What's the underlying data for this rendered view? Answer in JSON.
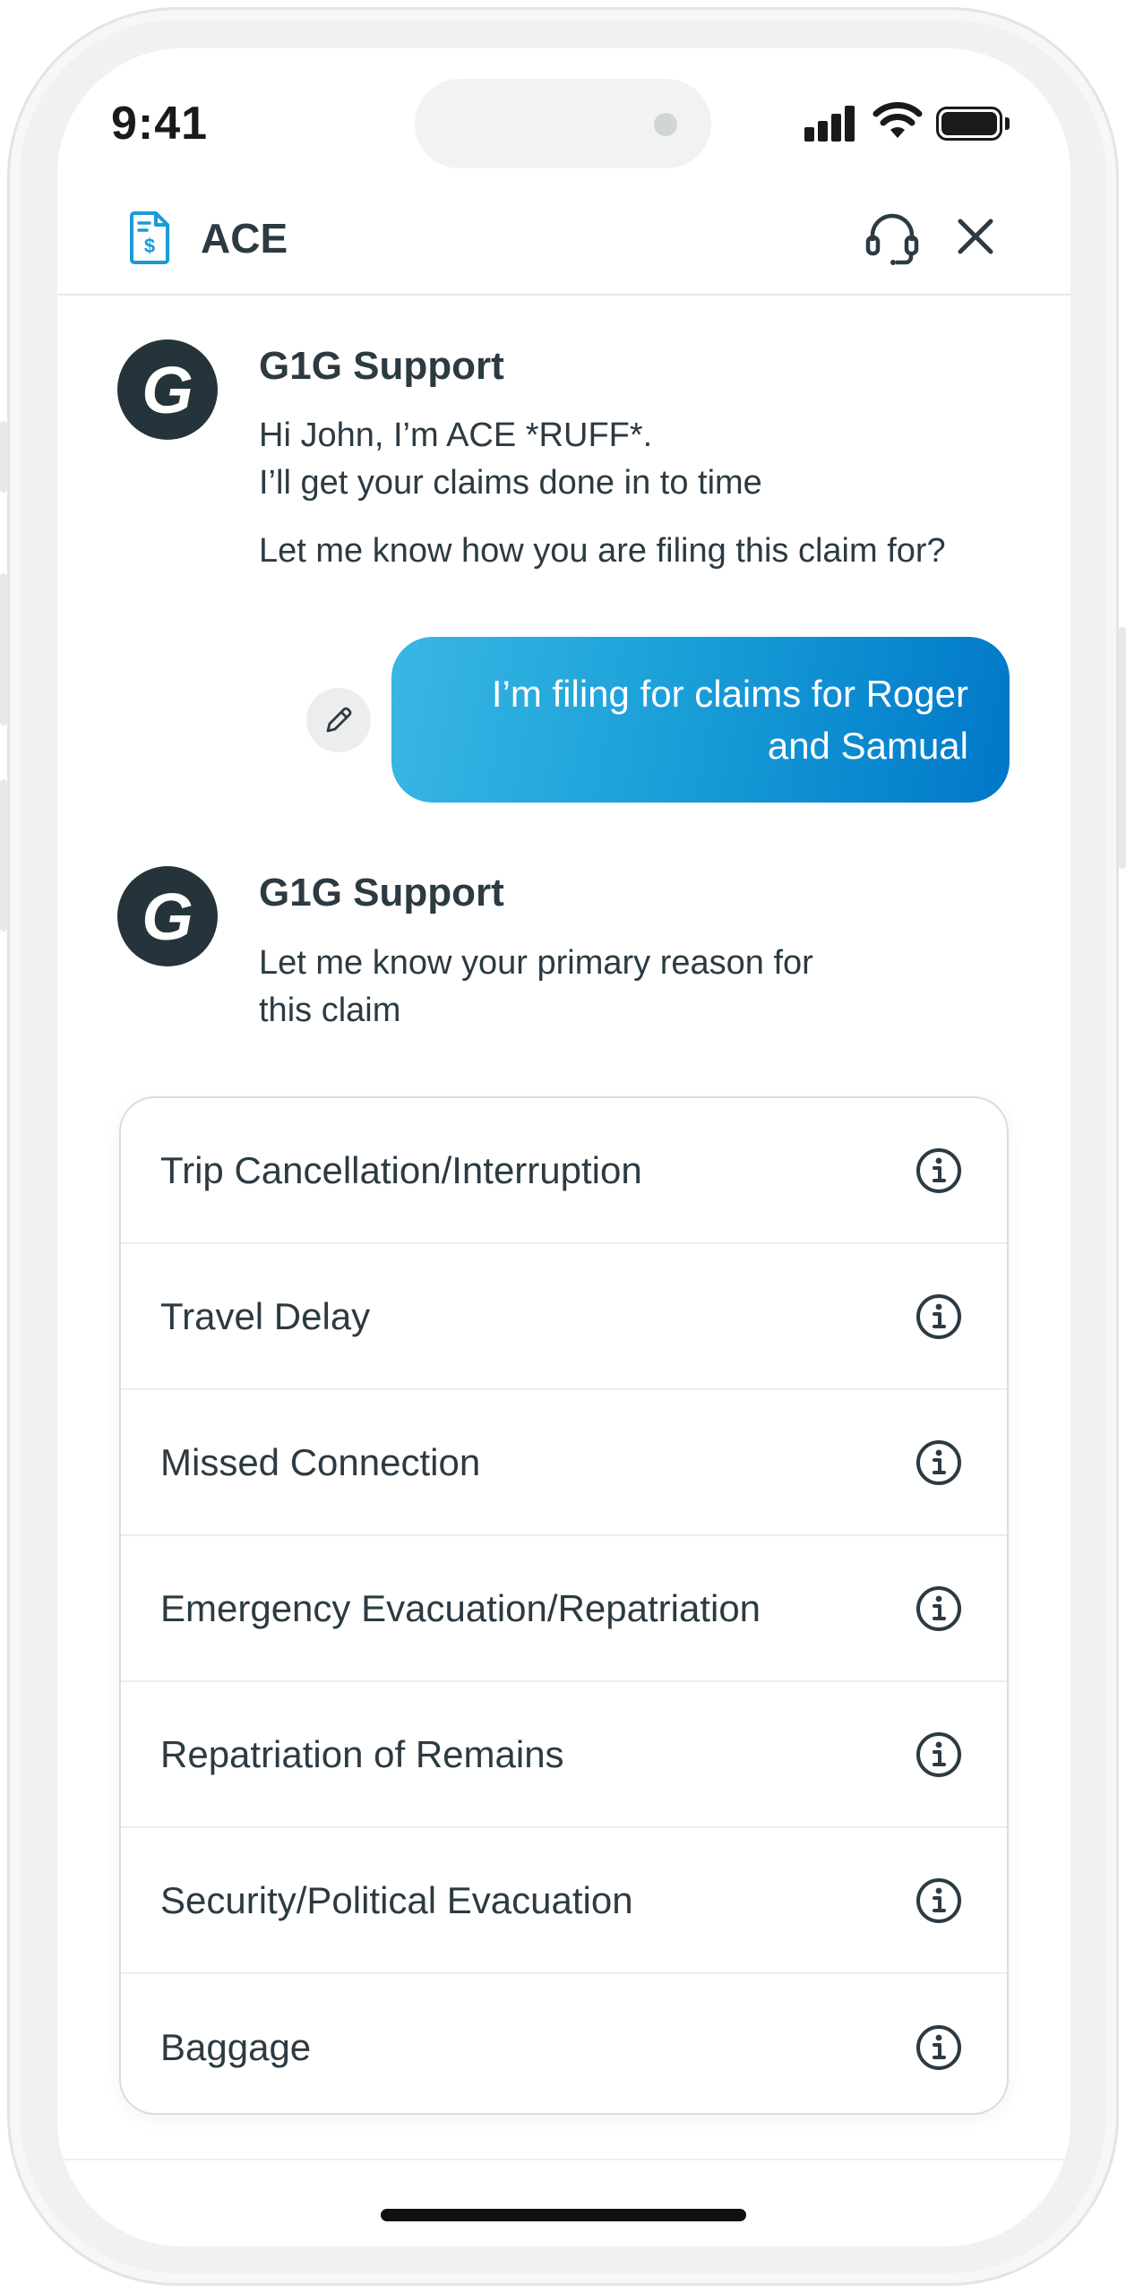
{
  "status_bar": {
    "time": "9:41"
  },
  "header": {
    "title": "ACE"
  },
  "messages": [
    {
      "sender": "G1G Support",
      "avatar_letter": "G",
      "lines": [
        "Hi John, I’m ACE *RUFF*.",
        "I’ll get your claims done in to time"
      ],
      "paragraph": "Let me know how you are filing this claim for?"
    },
    {
      "user_text_line1": "I’m filing for claims for Roger",
      "user_text_line2": "and Samual"
    },
    {
      "sender": "G1G Support",
      "avatar_letter": "G",
      "lines": [
        "Let me know your primary reason for",
        "this claim"
      ]
    }
  ],
  "options": [
    {
      "label": "Trip Cancellation/Interruption"
    },
    {
      "label": "Travel Delay"
    },
    {
      "label": "Missed Connection"
    },
    {
      "label": "Emergency Evacuation/Repatriation"
    },
    {
      "label": "Repatriation of Remains"
    },
    {
      "label": "Security/Political Evacuation"
    },
    {
      "label": "Baggage"
    }
  ],
  "colors": {
    "text": "#2c3a42",
    "avatar": "#24343a",
    "bubble_start": "#3ab7e4",
    "bubble_end": "#0077c8",
    "icon_accent": "#1a9ad6"
  },
  "icons": {
    "header_left": "document-dollar-icon",
    "header_support": "headset-icon",
    "header_close": "close-icon",
    "edit": "pencil-icon",
    "option_info": "info-icon"
  }
}
